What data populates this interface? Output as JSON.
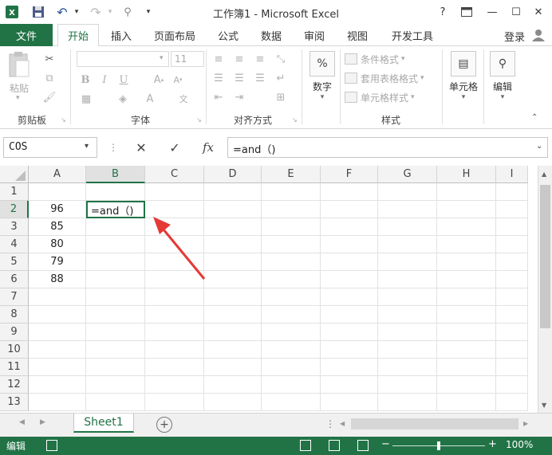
{
  "window": {
    "title": "工作簿1 - Microsoft Excel",
    "help": "?",
    "minimize": "—",
    "maximize": "☐",
    "close": "✕"
  },
  "ribbon_tabs": {
    "file": "文件",
    "items": [
      "开始",
      "插入",
      "页面布局",
      "公式",
      "数据",
      "审阅",
      "视图",
      "开发工具"
    ],
    "login": "登录"
  },
  "ribbon": {
    "clipboard": {
      "paste": "粘贴",
      "label": "剪贴板"
    },
    "font": {
      "size": "11",
      "label": "字体"
    },
    "alignment": {
      "label": "对齐方式"
    },
    "number": {
      "button": "数字",
      "icon_text": "%"
    },
    "styles": {
      "conditional": "条件格式",
      "table": "套用表格格式",
      "cell": "单元格样式",
      "label": "样式"
    },
    "cells": {
      "button": "单元格"
    },
    "editing": {
      "button": "编辑"
    }
  },
  "formula_bar": {
    "name_box": "COS",
    "cancel": "✕",
    "enter": "✓",
    "fx": "fx",
    "formula": "=and（)"
  },
  "grid": {
    "columns": [
      "A",
      "B",
      "C",
      "D",
      "E",
      "F",
      "G",
      "H",
      "I"
    ],
    "rows": [
      "1",
      "2",
      "3",
      "4",
      "5",
      "6",
      "7",
      "8",
      "9",
      "10",
      "11",
      "12",
      "13"
    ],
    "col_a_values": [
      "",
      "96",
      "85",
      "80",
      "79",
      "88"
    ],
    "active_cell_text": "=and（)",
    "selected_column": "B",
    "selected_row": "2"
  },
  "sheets": {
    "tabs": [
      "Sheet1"
    ],
    "add": "+"
  },
  "status": {
    "mode": "编辑",
    "zoom": "100%"
  },
  "colors": {
    "excel_green": "#217346",
    "arrow_red": "#e53935"
  }
}
